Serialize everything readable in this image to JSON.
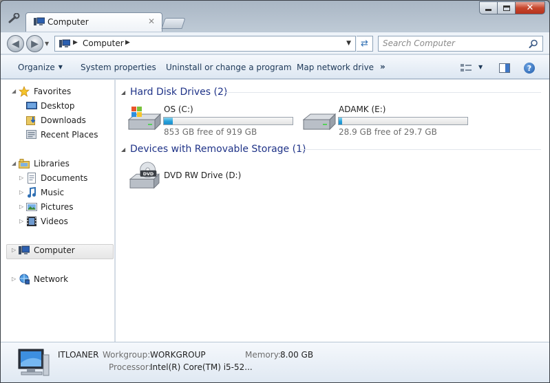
{
  "window": {
    "tab_title": "Computer",
    "close_label": "✕"
  },
  "address": {
    "crumb": "Computer",
    "search_placeholder": "Search Computer"
  },
  "commands": {
    "organize": "Organize",
    "system_properties": "System properties",
    "uninstall": "Uninstall or change a program",
    "map_drive": "Map network drive",
    "more": "»"
  },
  "nav": {
    "favorites": "Favorites",
    "desktop": "Desktop",
    "downloads": "Downloads",
    "recent_places": "Recent Places",
    "libraries": "Libraries",
    "documents": "Documents",
    "music": "Music",
    "pictures": "Pictures",
    "videos": "Videos",
    "computer": "Computer",
    "network": "Network"
  },
  "groups": {
    "hdd": "Hard Disk Drives (2)",
    "removable": "Devices with Removable Storage (1)"
  },
  "drives": [
    {
      "name": "OS (C:)",
      "free": "853 GB free of 919 GB",
      "used_fraction": 0.072
    },
    {
      "name": "ADAMK (E:)",
      "free": "28.9 GB free of 29.7 GB",
      "used_fraction": 0.027
    },
    {
      "name": "DVD RW Drive (D:)"
    }
  ],
  "details": {
    "computer_name": "ITLOANER",
    "workgroup_label": "Workgroup:",
    "workgroup": "WORKGROUP",
    "memory_label": "Memory:",
    "memory": "8.00 GB",
    "processor_label": "Processor:",
    "processor": "Intel(R) Core(TM) i5-52..."
  },
  "colors": {
    "group_header": "#1e3287",
    "capacity_fill": "#26a0da",
    "close_button": "#c7462c"
  }
}
